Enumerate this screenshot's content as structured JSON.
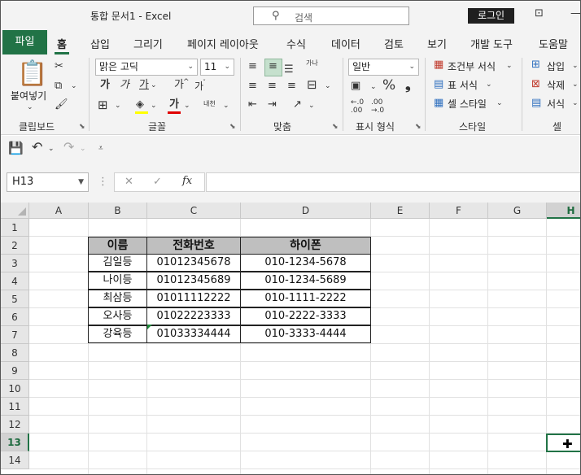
{
  "window": {
    "title": "통합 문서1  -  Excel",
    "search_placeholder": "검색",
    "login_label": "로그인"
  },
  "tabs": {
    "file": "파일",
    "items": [
      "홈",
      "삽입",
      "그리기",
      "페이지 레이아웃",
      "수식",
      "데이터",
      "검토",
      "보기",
      "개발 도구",
      "도움말"
    ],
    "active": "홈"
  },
  "ribbon": {
    "clipboard": {
      "paste_label": "붙여넣기",
      "group_label": "클립보드"
    },
    "font": {
      "font_name": "맑은 고딕",
      "font_size": "11",
      "group_label": "글꼴",
      "bold": "가",
      "italic": "가",
      "underline": "가",
      "grow": "가",
      "shrink": "가",
      "phonetic": "내천",
      "font_color": "가",
      "font_color_hex": "#e00000"
    },
    "alignment": {
      "group_label": "맞춤",
      "wrap": "가나"
    },
    "number": {
      "format": "일반",
      "group_label": "표시 형식",
      "percent": "%",
      "comma": "❟"
    },
    "styles": {
      "conditional": "조건부 서식",
      "table": "표 서식",
      "cell": "셀 스타일",
      "group_label": "스타일"
    },
    "cells": {
      "insert": "삽입",
      "delete": "삭제",
      "format": "서식",
      "group_label": "셀"
    }
  },
  "formula_bar": {
    "name_box": "H13",
    "fx": "fx",
    "formula": ""
  },
  "sheet": {
    "columns": [
      "A",
      "B",
      "C",
      "D",
      "E",
      "F",
      "G",
      "H"
    ],
    "rows": [
      "1",
      "2",
      "3",
      "4",
      "5",
      "6",
      "7",
      "8",
      "9",
      "10",
      "11",
      "12",
      "13",
      "14"
    ],
    "selected_column": "H",
    "selected_row": "13",
    "table": {
      "headers": [
        "이름",
        "전화번호",
        "하이폰"
      ],
      "rows": [
        [
          "김일등",
          "01012345678",
          "010-1234-5678"
        ],
        [
          "나이등",
          "01012345689",
          "010-1234-5689"
        ],
        [
          "최삼등",
          "01011112222",
          "010-1111-2222"
        ],
        [
          "오사등",
          "01022223333",
          "010-2222-3333"
        ],
        [
          "강육등",
          "01033334444",
          "010-3333-4444"
        ]
      ]
    }
  },
  "colors": {
    "accent": "#217346",
    "header_fill": "#bfbfbf"
  }
}
